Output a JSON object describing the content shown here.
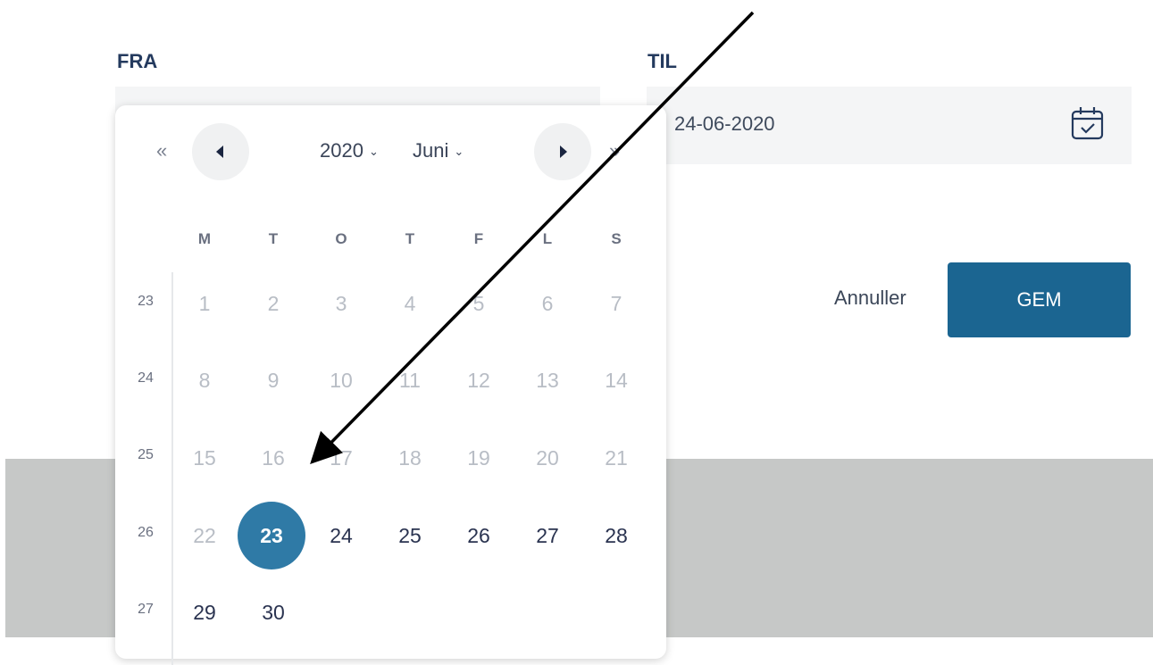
{
  "form": {
    "fra_label": "FRA",
    "til_label": "TIL",
    "til_value": "24-06-2020",
    "cancel_label": "Annuller",
    "save_label": "GEM"
  },
  "datepicker": {
    "prev_year_glyph": "«",
    "next_year_glyph": "»",
    "year": "2020",
    "month": "Juni",
    "chevron": "⌄",
    "weekdays": [
      "M",
      "T",
      "O",
      "T",
      "F",
      "L",
      "S"
    ],
    "weeks": [
      {
        "number": "23",
        "days": [
          "1",
          "2",
          "3",
          "4",
          "5",
          "6",
          "7"
        ]
      },
      {
        "number": "24",
        "days": [
          "8",
          "9",
          "10",
          "11",
          "12",
          "13",
          "14"
        ]
      },
      {
        "number": "25",
        "days": [
          "15",
          "16",
          "17",
          "18",
          "19",
          "20",
          "21"
        ]
      },
      {
        "number": "26",
        "days": [
          "22",
          "23",
          "24",
          "25",
          "26",
          "27",
          "28"
        ]
      },
      {
        "number": "27",
        "days": [
          "29",
          "30"
        ]
      }
    ],
    "selected_day": "23"
  },
  "colors": {
    "primary": "#1b6591",
    "selected": "#2f7aa6",
    "backdrop": "#c6c8c7"
  },
  "icons": {
    "calendar": "calendar-icon",
    "annotation": "arrow-annotation"
  }
}
